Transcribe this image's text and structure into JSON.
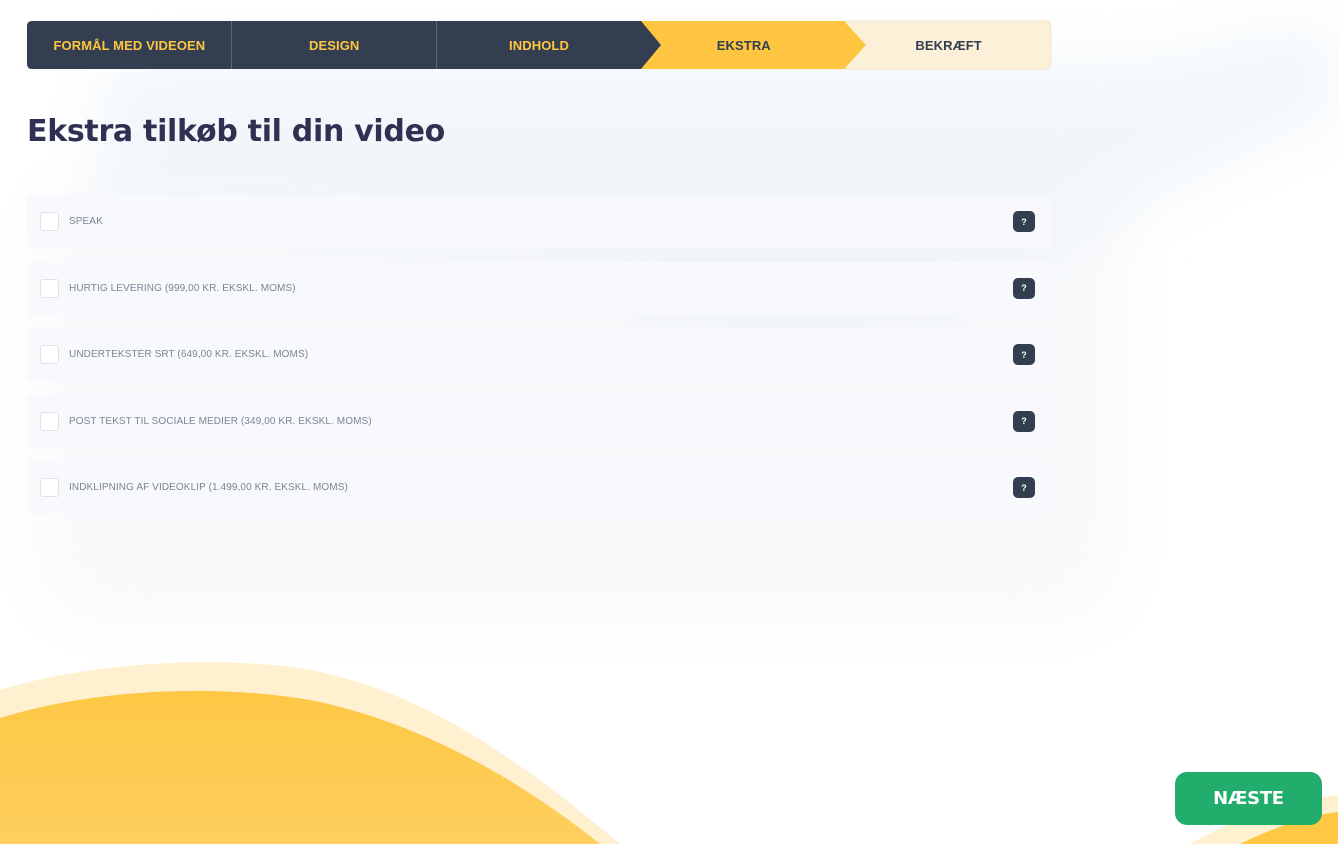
{
  "stepper": {
    "steps": [
      {
        "label": "FORMÅL MED VIDEOEN",
        "state": "done"
      },
      {
        "label": "DESIGN",
        "state": "done"
      },
      {
        "label": "INDHOLD",
        "state": "done"
      },
      {
        "label": "EKSTRA",
        "state": "active"
      },
      {
        "label": "BEKRÆFT",
        "state": "todo"
      }
    ]
  },
  "page": {
    "title": "Ekstra tilkøb til din video"
  },
  "options": [
    {
      "label": "SPEAK",
      "checked": false,
      "help": "?"
    },
    {
      "label": "HURTIG LEVERING (999,00 KR. EKSKL. MOMS)",
      "checked": false,
      "help": "?"
    },
    {
      "label": "UNDERTEKSTER SRT (649,00 KR. EKSKL. MOMS)",
      "checked": false,
      "help": "?"
    },
    {
      "label": "POST TEKST TIL SOCIALE MEDIER (349,00 KR. EKSKL. MOMS)",
      "checked": false,
      "help": "?"
    },
    {
      "label": "INDKLIPNING AF VIDEOKLIP (1.499,00 KR. EKSKL. MOMS)",
      "checked": false,
      "help": "?"
    }
  ],
  "actions": {
    "next_label": "NÆSTE"
  },
  "colors": {
    "dark": "#333f50",
    "accent": "#fec640",
    "pending": "#fcf0d8",
    "success": "#22ad6c",
    "heading": "#2f3152"
  }
}
